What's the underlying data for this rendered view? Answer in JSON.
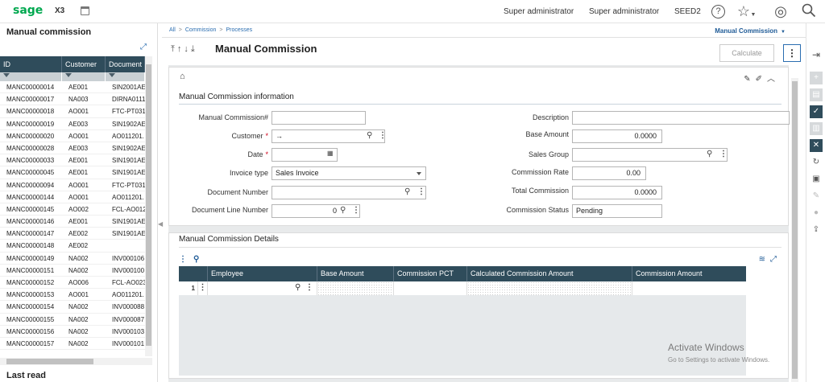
{
  "topbar": {
    "logo": "sage",
    "product": "X3",
    "user1": "Super administrator",
    "user2": "Super administrator",
    "folder": "SEED2",
    "help": "?",
    "star": "☆",
    "compass": "◎",
    "search": "⚲"
  },
  "left_panel": {
    "title": "Manual commission",
    "columns": [
      "ID",
      "Customer",
      "Document"
    ],
    "rows": [
      [
        "MANC00000014",
        "AE001",
        "SIN2001AE"
      ],
      [
        "MANC00000017",
        "NA003",
        "DIRNA0111"
      ],
      [
        "MANC00000018",
        "AO001",
        "FTC-PT031"
      ],
      [
        "MANC00000019",
        "AE003",
        "SIN1902AE"
      ],
      [
        "MANC00000020",
        "AO001",
        "AO011201."
      ],
      [
        "MANC00000028",
        "AE003",
        "SIN1902AE"
      ],
      [
        "MANC00000033",
        "AE001",
        "SIN1901AE"
      ],
      [
        "MANC00000045",
        "AE001",
        "SIN1901AE"
      ],
      [
        "MANC00000094",
        "AO001",
        "FTC-PT031"
      ],
      [
        "MANC00000144",
        "AO001",
        "AO011201."
      ],
      [
        "MANC00000145",
        "AO002",
        "FCL-AO012"
      ],
      [
        "MANC00000146",
        "AE001",
        "SIN1901AE"
      ],
      [
        "MANC00000147",
        "AE002",
        "SIN1901AE"
      ],
      [
        "MANC00000148",
        "AE002",
        ""
      ],
      [
        "MANC00000149",
        "NA002",
        "INV000106"
      ],
      [
        "MANC00000151",
        "NA002",
        "INV000100"
      ],
      [
        "MANC00000152",
        "AO006",
        "FCL-AO023"
      ],
      [
        "MANC00000153",
        "AO001",
        "AO011201."
      ],
      [
        "MANC00000154",
        "NA002",
        "INV000088"
      ],
      [
        "MANC00000155",
        "NA002",
        "INV000087"
      ],
      [
        "MANC00000156",
        "NA002",
        "INV000103"
      ],
      [
        "MANC00000157",
        "NA002",
        "INV000101"
      ]
    ],
    "last_read": "Last read"
  },
  "breadcrumb": {
    "items": [
      "All",
      "Commission",
      "Processes"
    ],
    "right": "Manual Commission"
  },
  "header": {
    "title": "Manual Commission",
    "calculate": "Calculate",
    "more": "⋮"
  },
  "info_section": {
    "title": "Manual Commission information",
    "fields": {
      "manual_commission_label": "Manual Commission#",
      "manual_commission_value": "",
      "customer_label": "Customer",
      "customer_value": "→",
      "date_label": "Date",
      "date_value": "",
      "invoice_type_label": "Invoice type",
      "invoice_type_value": "Sales Invoice",
      "document_number_label": "Document Number",
      "document_number_value": "",
      "document_line_label": "Document Line Number",
      "document_line_value": "0",
      "description_label": "Description",
      "description_value": "",
      "base_amount_label": "Base Amount",
      "base_amount_value": "0.0000",
      "sales_group_label": "Sales Group",
      "sales_group_value": "",
      "commission_rate_label": "Commission Rate",
      "commission_rate_value": "0.00",
      "total_commission_label": "Total Commission",
      "total_commission_value": "0.0000",
      "commission_status_label": "Commission Status",
      "commission_status_value": "Pending"
    }
  },
  "details_section": {
    "title": "Manual Commission Details",
    "columns": [
      "Employee",
      "Base Amount",
      "Commission PCT",
      "Calculated Commission Amount",
      "Commission Amount"
    ],
    "row_number": "1"
  },
  "watermark": {
    "line1": "Activate Windows",
    "line2": "Go to Settings to activate Windows."
  }
}
